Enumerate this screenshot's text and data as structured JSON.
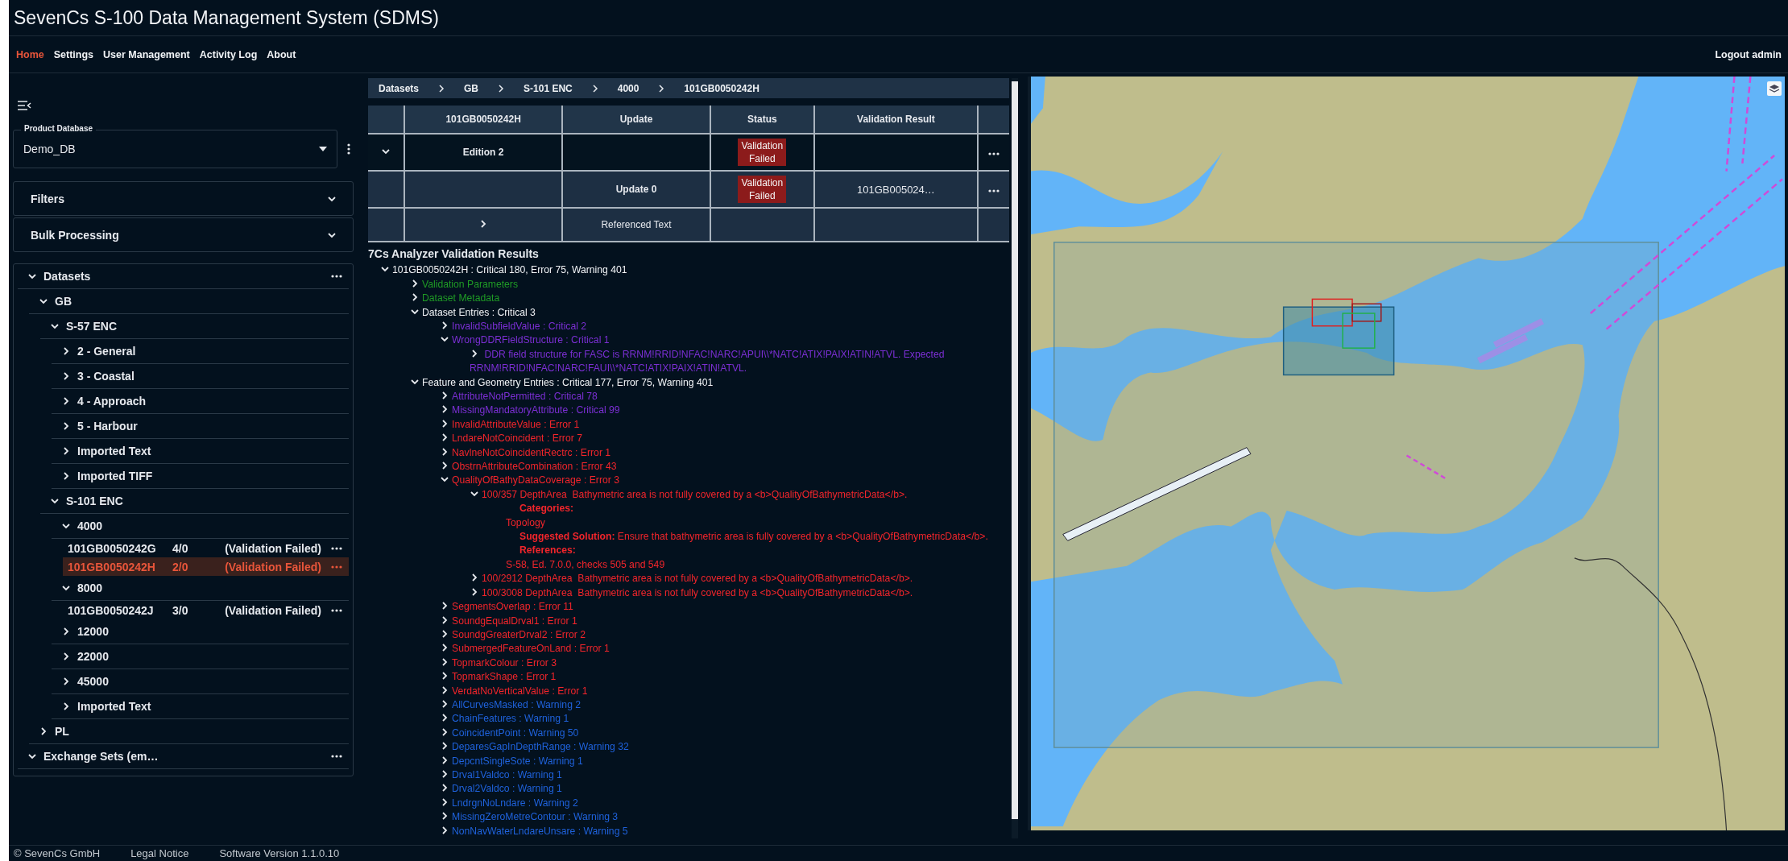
{
  "window": {
    "title": "SevenCs S-100 Data Management System (SDMS)"
  },
  "nav": [
    {
      "label": "Home",
      "selected": true
    },
    {
      "label": "Settings",
      "selected": false
    },
    {
      "label": "User Management",
      "selected": false
    },
    {
      "label": "Activity Log",
      "selected": false
    },
    {
      "label": "About",
      "selected": false
    }
  ],
  "logout": "Logout admin",
  "sidebar": {
    "product_database": {
      "label": "Product Database",
      "value": "Demo_DB"
    },
    "panels": [
      {
        "label": "Filters",
        "expanded": false
      },
      {
        "label": "Bulk Processing",
        "expanded": false
      }
    ],
    "tree": [
      {
        "kind": "root",
        "label": "Datasets",
        "expanded": true,
        "children": [
          {
            "kind": "folder",
            "label": "GB",
            "expanded": true,
            "children": [
              {
                "kind": "folder",
                "label": "S-57 ENC",
                "expanded": true,
                "children": [
                  {
                    "kind": "folder",
                    "label": "2 - General",
                    "expanded": false
                  },
                  {
                    "kind": "folder",
                    "label": "3 - Coastal",
                    "expanded": false
                  },
                  {
                    "kind": "folder",
                    "label": "4 - Approach",
                    "expanded": false
                  },
                  {
                    "kind": "folder",
                    "label": "5 - Harbour",
                    "expanded": false
                  },
                  {
                    "kind": "folder",
                    "label": "Imported Text",
                    "expanded": false
                  },
                  {
                    "kind": "folder",
                    "label": "Imported TIFF",
                    "expanded": false
                  }
                ]
              },
              {
                "kind": "folder",
                "label": "S-101 ENC",
                "expanded": true,
                "children": [
                  {
                    "kind": "folder",
                    "label": "4000",
                    "expanded": true,
                    "children": [
                      {
                        "kind": "dataset",
                        "label": "101GB0050242G",
                        "count": "4/0",
                        "status": "(Validation Failed)",
                        "selected": false
                      },
                      {
                        "kind": "dataset",
                        "label": "101GB0050242H",
                        "count": "2/0",
                        "status": "(Validation Failed)",
                        "selected": true
                      }
                    ]
                  },
                  {
                    "kind": "folder",
                    "label": "8000",
                    "expanded": true,
                    "children": [
                      {
                        "kind": "dataset",
                        "label": "101GB0050242J",
                        "count": "3/0",
                        "status": "(Validation Failed)",
                        "selected": false
                      }
                    ]
                  },
                  {
                    "kind": "folder",
                    "label": "12000",
                    "expanded": false
                  },
                  {
                    "kind": "folder",
                    "label": "22000",
                    "expanded": false
                  },
                  {
                    "kind": "folder",
                    "label": "45000",
                    "expanded": false
                  },
                  {
                    "kind": "folder",
                    "label": "Imported Text",
                    "expanded": false
                  }
                ]
              }
            ]
          },
          {
            "kind": "folder",
            "label": "PL",
            "expanded": false
          }
        ]
      },
      {
        "kind": "root",
        "label": "Exchange Sets (em…",
        "expanded": true
      }
    ]
  },
  "breadcrumb": [
    "Datasets",
    "GB",
    "S-101 ENC",
    "4000",
    "101GB0050242H"
  ],
  "table": {
    "columns": [
      "101GB0050242H",
      "Update",
      "Status",
      "Validation Result"
    ],
    "rows": [
      {
        "kind": "edition",
        "expanded": true,
        "name": "Edition 2",
        "status": "Validation Failed",
        "menu": true
      },
      {
        "kind": "update",
        "update": "Update 0",
        "status": "Validation Failed",
        "result": "101GB005024…",
        "menu": true
      },
      {
        "kind": "group",
        "expanded": false,
        "update": "Referenced Text",
        "menu": false
      }
    ]
  },
  "results": {
    "title": "7Cs Analyzer Validation Results",
    "tree": [
      {
        "kind": "summary",
        "text": "101GB0050242H : Critical 180, Error 75, Warning 401",
        "expanded": true,
        "children": [
          {
            "kind": "meta",
            "text": "Validation Parameters",
            "expanded": false
          },
          {
            "kind": "meta",
            "text": "Dataset Metadata",
            "expanded": false
          },
          {
            "kind": "summary",
            "text": "Dataset Entries : Critical 3",
            "expanded": true,
            "children": [
              {
                "kind": "critical",
                "text": "InvalidSubfieldValue : Critical 2",
                "expanded": false
              },
              {
                "kind": "critical",
                "text": "WrongDDRFieldStructure : Critical 1",
                "expanded": true,
                "children": [
                  {
                    "kind": "critical",
                    "text": " DDR field structure for FASC is RRNM!RRID!NFAC!NARC!APUI\\\\*NATC!ATIX!PAIX!ATIN!ATVL. Expected RRNM!RRID!NFAC!NARC!FAUI\\\\*NATC!ATIX!PAIX!ATIN!ATVL.",
                    "expanded": false
                  }
                ]
              }
            ]
          },
          {
            "kind": "summary",
            "text": "Feature and Geometry Entries : Critical 177, Error 75, Warning 401",
            "expanded": true,
            "children": [
              {
                "kind": "critical",
                "text": "AttributeNotPermitted : Critical 78",
                "expanded": false
              },
              {
                "kind": "critical",
                "text": "MissingMandatoryAttribute : Critical 99",
                "expanded": false
              },
              {
                "kind": "error",
                "text": "InvalidAttributeValue : Error 1",
                "expanded": false
              },
              {
                "kind": "error",
                "text": "LndareNotCoincident : Error 7",
                "expanded": false
              },
              {
                "kind": "error",
                "text": "NavlneNotCoincidentRectrc : Error 1",
                "expanded": false
              },
              {
                "kind": "error",
                "text": "ObstrnAttributeCombination : Error 43",
                "expanded": false
              },
              {
                "kind": "error",
                "text": "QualityOfBathyDataCoverage : Error 3",
                "expanded": true,
                "children": [
                  {
                    "kind": "error",
                    "text": "100/357 DepthArea  Bathymetric area is not fully covered by a <b>QualityOfBathymetricData</b>.",
                    "expanded": true,
                    "details": [
                      {
                        "kind": "label",
                        "text": "Categories:"
                      },
                      {
                        "kind": "value",
                        "text": "Topology"
                      },
                      {
                        "kind": "note",
                        "text": "**Suggested Solution:** Ensure that bathymetric area is fully covered by a <b>QualityOfBathymetricData</b>."
                      },
                      {
                        "kind": "label",
                        "text": "References:"
                      },
                      {
                        "kind": "value",
                        "text": "S-58, Ed. 7.0.0, checks 505 and 549"
                      }
                    ]
                  },
                  {
                    "kind": "error",
                    "text": "100/2912 DepthArea  Bathymetric area is not fully covered by a <b>QualityOfBathymetricData</b>.",
                    "expanded": false
                  },
                  {
                    "kind": "error",
                    "text": "100/3008 DepthArea  Bathymetric area is not fully covered by a <b>QualityOfBathymetricData</b>.",
                    "expanded": false
                  }
                ]
              },
              {
                "kind": "error",
                "text": "SegmentsOverlap : Error 11",
                "expanded": false
              },
              {
                "kind": "error",
                "text": "SoundgEqualDrval1 : Error 1",
                "expanded": false
              },
              {
                "kind": "error",
                "text": "SoundgGreaterDrval2 : Error 2",
                "expanded": false
              },
              {
                "kind": "error",
                "text": "SubmergedFeatureOnLand : Error 1",
                "expanded": false
              },
              {
                "kind": "error",
                "text": "TopmarkColour : Error 3",
                "expanded": false
              },
              {
                "kind": "error",
                "text": "TopmarkShape : Error 1",
                "expanded": false
              },
              {
                "kind": "error",
                "text": "VerdatNoVerticalValue : Error 1",
                "expanded": false
              },
              {
                "kind": "warning",
                "text": "AllCurvesMasked : Warning 2",
                "expanded": false
              },
              {
                "kind": "warning",
                "text": "ChainFeatures : Warning 1",
                "expanded": false
              },
              {
                "kind": "warning",
                "text": "CoincidentPoint : Warning 50",
                "expanded": false
              },
              {
                "kind": "warning",
                "text": "DeparesGapInDepthRange : Warning 32",
                "expanded": false
              },
              {
                "kind": "warning",
                "text": "DepcntSingleSote : Warning 1",
                "expanded": false
              },
              {
                "kind": "warning",
                "text": "Drval1Valdco : Warning 1",
                "expanded": false
              },
              {
                "kind": "warning",
                "text": "Drval2Valdco : Warning 1",
                "expanded": false
              },
              {
                "kind": "warning",
                "text": "LndrgnNoLndare : Warning 2",
                "expanded": false
              },
              {
                "kind": "warning",
                "text": "MissingZeroMetreContour : Warning 3",
                "expanded": false
              },
              {
                "kind": "warning",
                "text": "NonNavWaterLndareUnsare : Warning 5",
                "expanded": false
              }
            ]
          }
        ]
      }
    ]
  },
  "footer": [
    "© SevenCs GmbH",
    "Legal Notice",
    "Software Version 1.1.0.10"
  ]
}
